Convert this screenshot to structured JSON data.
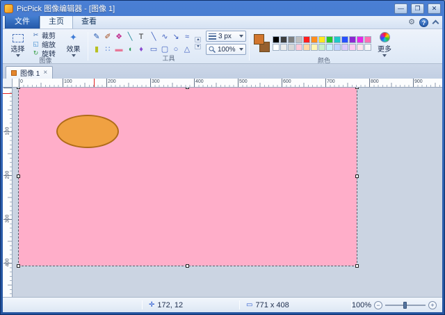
{
  "window": {
    "title": "PicPick 图像编辑器 - [图像 1]",
    "minimize": "—",
    "maximize": "❐",
    "close": "✕"
  },
  "menubar": {
    "file": "文件",
    "home": "主页",
    "view": "查看",
    "settings_glyph": "⚙",
    "help_glyph": "?"
  },
  "ribbon": {
    "image_group": {
      "label": "图像",
      "select": "选择",
      "crop": "裁剪",
      "crop_icon": "✂",
      "resize": "缩放",
      "resize_icon": "◱",
      "rotate": "旋转",
      "rotate_icon": "↻",
      "effects": "效果",
      "effects_icon": "✦"
    },
    "tools_group": {
      "label": "工具",
      "row1": [
        {
          "name": "pencil",
          "glyph": "✎",
          "color": "#1f55b0"
        },
        {
          "name": "brush",
          "glyph": "✐",
          "color": "#a04818"
        },
        {
          "name": "color-picker",
          "glyph": "❖",
          "color": "#c03090"
        },
        {
          "name": "eyedropper",
          "glyph": "╲",
          "color": "#208898"
        },
        {
          "name": "text",
          "glyph": "T",
          "color": "#303030"
        }
      ],
      "row2": [
        {
          "name": "highlighter",
          "glyph": "▮",
          "color": "#b8c020"
        },
        {
          "name": "airbrush",
          "glyph": "∷",
          "color": "#4878d0"
        },
        {
          "name": "eraser",
          "glyph": "▬",
          "color": "#e87898"
        },
        {
          "name": "fill",
          "glyph": "◖",
          "color": "#2f9e5a"
        },
        {
          "name": "stamp",
          "glyph": "♦",
          "color": "#8a4ad0"
        }
      ],
      "lines": [
        {
          "name": "line",
          "glyph": "╲",
          "color": "#4060c0"
        },
        {
          "name": "curve",
          "glyph": "∿",
          "color": "#4060c0"
        },
        {
          "name": "arrow",
          "glyph": "↘",
          "color": "#4060c0"
        },
        {
          "name": "freeform",
          "glyph": "≈",
          "color": "#4060c0"
        }
      ],
      "shapes": [
        {
          "name": "rectangle",
          "glyph": "▭",
          "color": "#4060c0"
        },
        {
          "name": "rounded-rectangle",
          "glyph": "▢",
          "color": "#4060c0"
        },
        {
          "name": "ellipse",
          "glyph": "○",
          "color": "#4060c0"
        },
        {
          "name": "polygon",
          "glyph": "△",
          "color": "#4060c0"
        }
      ],
      "line_width": "3 px",
      "zoom": "100%"
    },
    "colors_group": {
      "label": "颜色",
      "foreground": "#d2762e",
      "background": "#96602e",
      "palette": [
        [
          "#000000",
          "#3f3f3f",
          "#7f7f7f",
          "#bfbfbf",
          "#ff1e1e",
          "#ff8c1e",
          "#ffe61e",
          "#28c828",
          "#1ec8c8",
          "#2850ff",
          "#8c28d2",
          "#e628e6",
          "#ff6eb4"
        ],
        [
          "#ffffff",
          "#ebebeb",
          "#d7d7d7",
          "#ffc8d7",
          "#ffd7a5",
          "#fff5b4",
          "#c8f0c8",
          "#c8f0fa",
          "#bed2ff",
          "#dcc8fa",
          "#ffc8f0",
          "#ffe1eb",
          "#f5f5f5"
        ]
      ],
      "more": "更多"
    }
  },
  "document_tab": {
    "label": "图像 1",
    "close_glyph": "×"
  },
  "rulers": {
    "horizontal": [
      "0",
      "100",
      "200",
      "300",
      "400",
      "500",
      "600",
      "700",
      "800",
      "900"
    ],
    "vertical": [
      "100",
      "200",
      "300",
      "400"
    ]
  },
  "canvas": {
    "image_color": "#ffaec9",
    "ellipse": {
      "fill": "#f0a142",
      "stroke": "#b06c1a"
    }
  },
  "statusbar": {
    "cursor_icon": "✛",
    "cursor": "172, 12",
    "size_icon": "▭",
    "size": "771 x 408",
    "zoom": "100%",
    "zoom_out": "−",
    "zoom_in": "+"
  }
}
